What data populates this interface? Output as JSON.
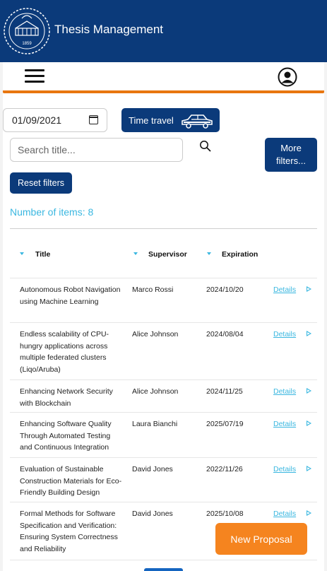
{
  "header": {
    "title": "Thesis Management",
    "logo_icon": "university-seal-logo",
    "logo_year": "1859",
    "background": "#0b3a7a"
  },
  "navbar": {
    "menu_icon": "hamburger-menu-icon",
    "user_icon": "user-account-icon",
    "accent": "#e8760f"
  },
  "filters": {
    "date_value": "01/09/2021",
    "time_travel_label": "Time travel",
    "search_placeholder": "Search title...",
    "more_filters_label": "More filters...",
    "reset_filters_label": "Reset filters"
  },
  "summary": {
    "items_label": "Number of items: 8"
  },
  "table": {
    "columns": [
      "Title",
      "Supervisor",
      "Expiration"
    ],
    "rows": [
      {
        "title": "Autonomous Robot Navigation using Machine Learning",
        "supervisor": "Marco Rossi",
        "expiration": "2024/10/20",
        "details": "Details"
      },
      {
        "title": "Endless scalability of CPU-hungry applications across multiple federated clusters (Liqo/Aruba)",
        "supervisor": "Alice Johnson",
        "expiration": "2024/08/04",
        "details": "Details"
      },
      {
        "title": "Enhancing Network Security with Blockchain",
        "supervisor": "Alice Johnson",
        "expiration": "2024/11/25",
        "details": "Details"
      },
      {
        "title": "Enhancing Software Quality Through Automated Testing and Continuous Integration",
        "supervisor": "Laura Bianchi",
        "expiration": "2025/07/19",
        "details": "Details"
      },
      {
        "title": "Evaluation of Sustainable Construction Materials for Eco-Friendly Building Design",
        "supervisor": "David Jones",
        "expiration": "2022/11/26",
        "details": "Details"
      },
      {
        "title": "Formal Methods for Software Specification and Verification: Ensuring System Correctness and Reliability",
        "supervisor": "David Jones",
        "expiration": "2025/10/08",
        "details": "Details"
      }
    ]
  },
  "actions": {
    "new_proposal_label": "New Proposal"
  }
}
